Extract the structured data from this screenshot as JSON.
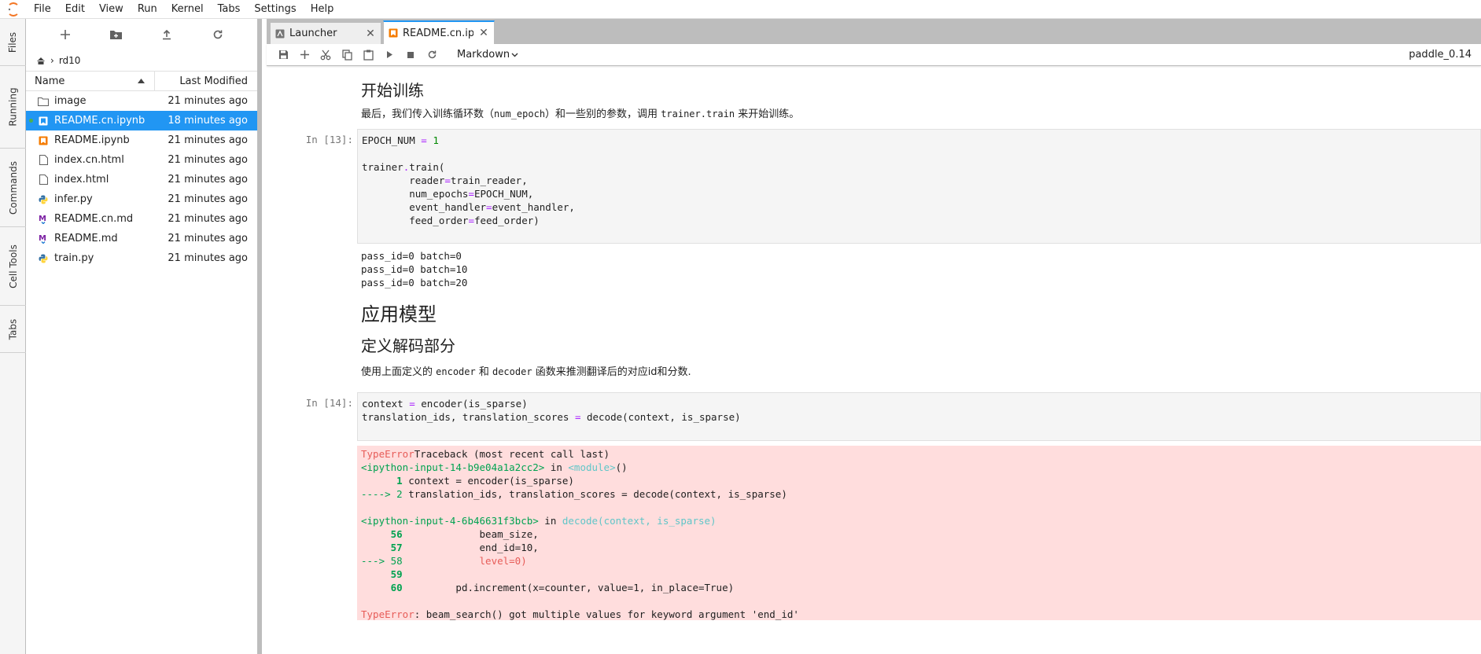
{
  "menubar": {
    "items": [
      "File",
      "Edit",
      "View",
      "Run",
      "Kernel",
      "Tabs",
      "Settings",
      "Help"
    ]
  },
  "left_tabs": [
    "Files",
    "Running",
    "Commands",
    "Cell Tools",
    "Tabs"
  ],
  "filebrowser": {
    "breadcrumb": "rd10",
    "header": {
      "name": "Name",
      "modified": "Last Modified"
    },
    "files": [
      {
        "name": "image",
        "modified": "21 minutes ago",
        "icon": "folder-icon"
      },
      {
        "name": "README.cn.ipynb",
        "modified": "18 minutes ago",
        "icon": "notebook-icon",
        "selected": true,
        "running": true
      },
      {
        "name": "README.ipynb",
        "modified": "21 minutes ago",
        "icon": "notebook-icon"
      },
      {
        "name": "index.cn.html",
        "modified": "21 minutes ago",
        "icon": "file-icon"
      },
      {
        "name": "index.html",
        "modified": "21 minutes ago",
        "icon": "file-icon"
      },
      {
        "name": "infer.py",
        "modified": "21 minutes ago",
        "icon": "python-icon"
      },
      {
        "name": "README.cn.md",
        "modified": "21 minutes ago",
        "icon": "markdown-icon"
      },
      {
        "name": "README.md",
        "modified": "21 minutes ago",
        "icon": "markdown-icon"
      },
      {
        "name": "train.py",
        "modified": "21 minutes ago",
        "icon": "python-icon"
      }
    ]
  },
  "tabs": [
    {
      "label": "Launcher"
    },
    {
      "label": "README.cn.ipy"
    }
  ],
  "toolbar": {
    "cell_type": "Markdown",
    "kernel": "paddle_0.14"
  },
  "notebook": {
    "h_train": "开始训练",
    "p_train_pre": "最后，我们传入训练循环数（",
    "p_train_code1": "num_epoch",
    "p_train_mid": "）和一些别的参数，调用 ",
    "p_train_code2": "trainer.train",
    "p_train_post": " 来开始训练。",
    "prompt13": "In [13]:",
    "prompt14": "In [14]:",
    "out13": [
      "pass_id=0 batch=0",
      "pass_id=0 batch=10",
      "pass_id=0 batch=20"
    ],
    "h_apply": "应用模型",
    "h_decode": "定义解码部分",
    "p_decode_pre": "使用上面定义的 ",
    "p_decode_code1": "encoder",
    "p_decode_mid": " 和 ",
    "p_decode_code2": "decoder",
    "p_decode_post": " 函数来推测翻译后的对应id和分数.",
    "err_type": "TypeError",
    "err_tb_head": "Traceback (most recent call last)",
    "err_input1": "<ipython-input-14-b9e04a1a2cc2>",
    "err_in": " in ",
    "err_module": "<module>",
    "err_module_paren": "()",
    "err_l1_num": "      1 ",
    "err_l1_code": "context = encoder(is_sparse)",
    "err_l2_arrow": "----> 2 ",
    "err_l2_code": "translation_ids, translation_scores = decode(context, is_sparse)",
    "err_input2": "<ipython-input-4-6b46631f3bcb>",
    "err_decode": "decode",
    "err_decode_args": "(context, is_sparse)",
    "err_l56_num": "     56 ",
    "err_l56_code": "            beam_size,",
    "err_l57_num": "     57 ",
    "err_l57_code": "            end_id=10,",
    "err_l58_arrow": "---> 58 ",
    "err_l58_code": "            level=0)",
    "err_l59_num": "     59 ",
    "err_l60_num": "     60 ",
    "err_l60_code": "        pd.increment(x=counter, value=1, in_place=True)",
    "err_final_type": "TypeError",
    "err_final_msg": ": beam_search() got multiple values for keyword argument 'end_id'"
  }
}
